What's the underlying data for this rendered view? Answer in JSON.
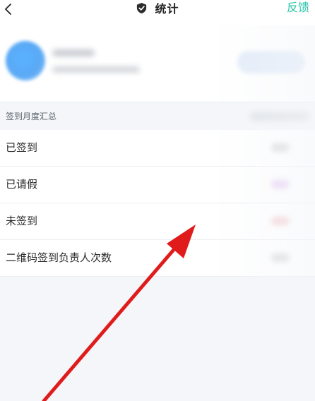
{
  "header": {
    "title": "统计",
    "feedback_label": "反馈",
    "back_icon": "chevron-left-icon",
    "title_icon": "shield-check-icon"
  },
  "section": {
    "title": "签到月度汇总"
  },
  "stats": [
    {
      "label": "已签到",
      "value_color": "#dcdcdc"
    },
    {
      "label": "已请假",
      "value_color": "#e9d3f5"
    },
    {
      "label": "未签到",
      "value_color": "#f5d2d6"
    },
    {
      "label": "二维码签到负责人次数",
      "value_color": "#dcdcdc"
    }
  ],
  "colors": {
    "accent": "#27c3a8",
    "annotation_arrow": "#e01b1b"
  }
}
